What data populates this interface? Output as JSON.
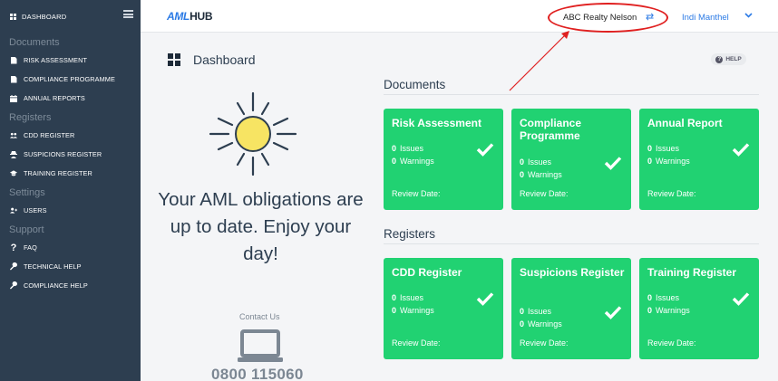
{
  "sidebar": {
    "dashboard_label": "DASHBOARD",
    "sections": {
      "documents": "Documents",
      "registers": "Registers",
      "settings": "Settings",
      "support": "Support"
    },
    "documents_items": [
      "RISK ASSESSMENT",
      "COMPLIANCE PROGRAMME",
      "ANNUAL REPORTS"
    ],
    "registers_items": [
      "CDD REGISTER",
      "SUSPICIONS REGISTER",
      "TRAINING REGISTER"
    ],
    "settings_items": [
      "USERS"
    ],
    "support_items": [
      "FAQ",
      "TECHNICAL HELP",
      "COMPLIANCE HELP"
    ]
  },
  "topbar": {
    "logo_aml": "AML",
    "logo_hub": "HUB",
    "organisation": "ABC Realty Nelson",
    "swap_glyph": "⇄",
    "user_name": "Indi Manthel",
    "chevron": "⌄"
  },
  "main": {
    "title": "Dashboard",
    "help_label": "HELP",
    "message": "Your AML obligations are up to date. Enjoy your day!",
    "contact_label": "Contact Us",
    "phone": "0800 115060",
    "documents_heading": "Documents",
    "registers_heading": "Registers"
  },
  "cards": {
    "issues_label": "Issues",
    "warnings_label": "Warnings",
    "review_label": "Review Date:",
    "documents": [
      {
        "title": "Risk Assessment",
        "issues": "0",
        "warnings": "0"
      },
      {
        "title": "Compliance Programme",
        "issues": "0",
        "warnings": "0"
      },
      {
        "title": "Annual Report",
        "issues": "0",
        "warnings": "0"
      }
    ],
    "registers": [
      {
        "title": "CDD Register",
        "issues": "0",
        "warnings": "0"
      },
      {
        "title": "Suspicions Register",
        "issues": "0",
        "warnings": "0"
      },
      {
        "title": "Training Register",
        "issues": "0",
        "warnings": "0"
      }
    ]
  },
  "colors": {
    "sidebar_bg": "#2d3e50",
    "card_green": "#21d272",
    "accent_blue": "#2c7be5",
    "annotation_red": "#e02020",
    "sun_yellow": "#f7e463"
  },
  "icons": {
    "dashboard": "grid-icon",
    "menu": "hamburger-icon",
    "document": "document-icon",
    "calendar": "calendar-icon",
    "users": "users-icon",
    "suspicion": "spy-icon",
    "training": "graduation-cap-icon",
    "user": "user-icon",
    "faq": "question-icon",
    "wrench": "wrench-icon",
    "check": "check-icon",
    "sun": "sun-icon",
    "laptop": "laptop-icon"
  }
}
